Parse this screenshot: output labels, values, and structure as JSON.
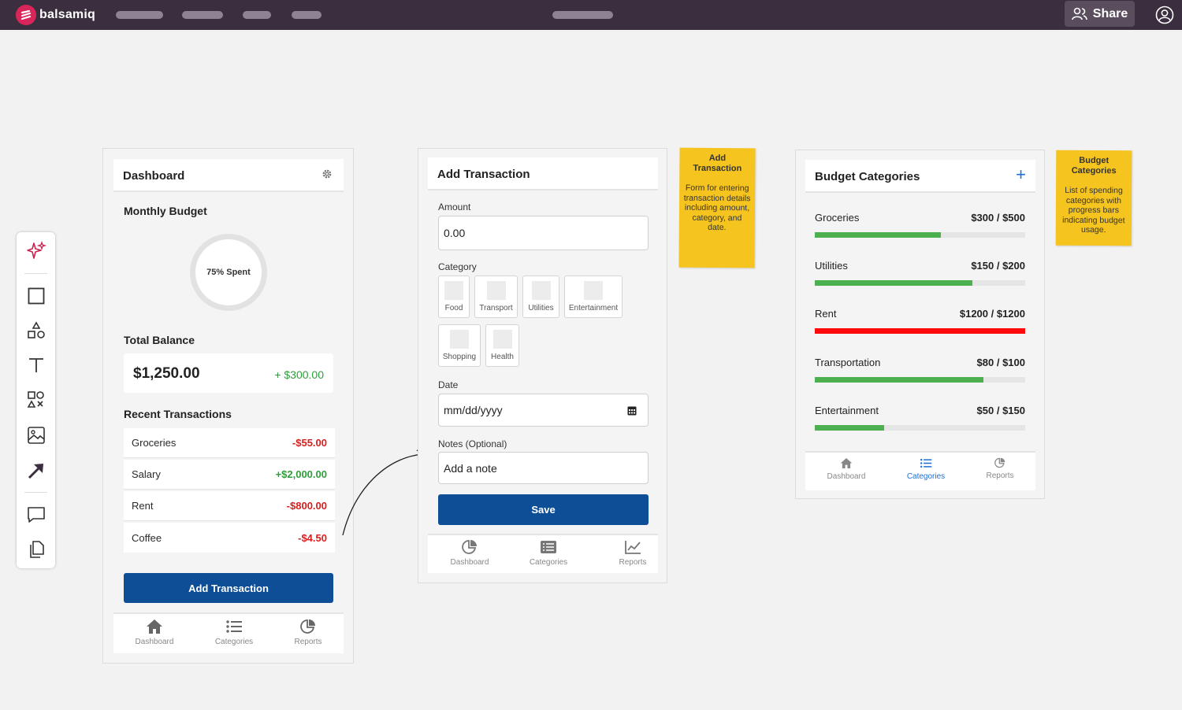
{
  "app": {
    "name": "balsamiq",
    "share_label": "Share"
  },
  "colors": {
    "topbar": "#3b2e3e",
    "primary": "#0d4e96",
    "negative": "#d61f1f",
    "positive": "#2e9e3a",
    "progress_ok": "#4caf50",
    "progress_full": "#ff0a0a",
    "sticky": "#f5c41e",
    "active_tab": "#1f6fd6"
  },
  "dashboard": {
    "title": "Dashboard",
    "monthly_budget_title": "Monthly Budget",
    "budget_ring_label": "75% Spent",
    "budget_ring_percent": 75,
    "total_balance_title": "Total Balance",
    "balance": "$1,250.00",
    "balance_change": "+ $300.00",
    "recent_title": "Recent Transactions",
    "transactions": [
      {
        "name": "Groceries",
        "amount": "-$55.00",
        "type": "neg"
      },
      {
        "name": "Salary",
        "amount": "+$2,000.00",
        "type": "pos"
      },
      {
        "name": "Rent",
        "amount": "-$800.00",
        "type": "neg"
      },
      {
        "name": "Coffee",
        "amount": "-$4.50",
        "type": "neg"
      }
    ],
    "add_button": "Add Transaction",
    "nav": [
      "Dashboard",
      "Categories",
      "Reports"
    ]
  },
  "add_transaction": {
    "title": "Add Transaction",
    "amount_label": "Amount",
    "amount_value": "0.00",
    "category_label": "Category",
    "categories": [
      "Food",
      "Transport",
      "Utilities",
      "Entertainment",
      "Shopping",
      "Health"
    ],
    "date_label": "Date",
    "date_placeholder": "mm/dd/yyyy",
    "notes_label": "Notes (Optional)",
    "notes_placeholder": "Add a note",
    "save_button": "Save",
    "nav": [
      "Dashboard",
      "Categories",
      "Reports"
    ]
  },
  "budget_categories": {
    "title": "Budget Categories",
    "items": [
      {
        "name": "Groceries",
        "amount": "$300 / $500",
        "fraction": 0.6
      },
      {
        "name": "Utilities",
        "amount": "$150 / $200",
        "fraction": 0.75
      },
      {
        "name": "Rent",
        "amount": "$1200 / $1200",
        "fraction": 1.0
      },
      {
        "name": "Transportation",
        "amount": "$80 / $100",
        "fraction": 0.8
      },
      {
        "name": "Entertainment",
        "amount": "$50 / $150",
        "fraction": 0.33
      }
    ],
    "nav": [
      "Dashboard",
      "Categories",
      "Reports"
    ],
    "active_nav": "Categories"
  },
  "sticky_notes": [
    {
      "title": "Add Transaction",
      "body": "Form for entering transaction details including amount, category, and date."
    },
    {
      "title": "Budget Categories",
      "body": "List of spending categories with progress bars indicating budget usage."
    }
  ]
}
